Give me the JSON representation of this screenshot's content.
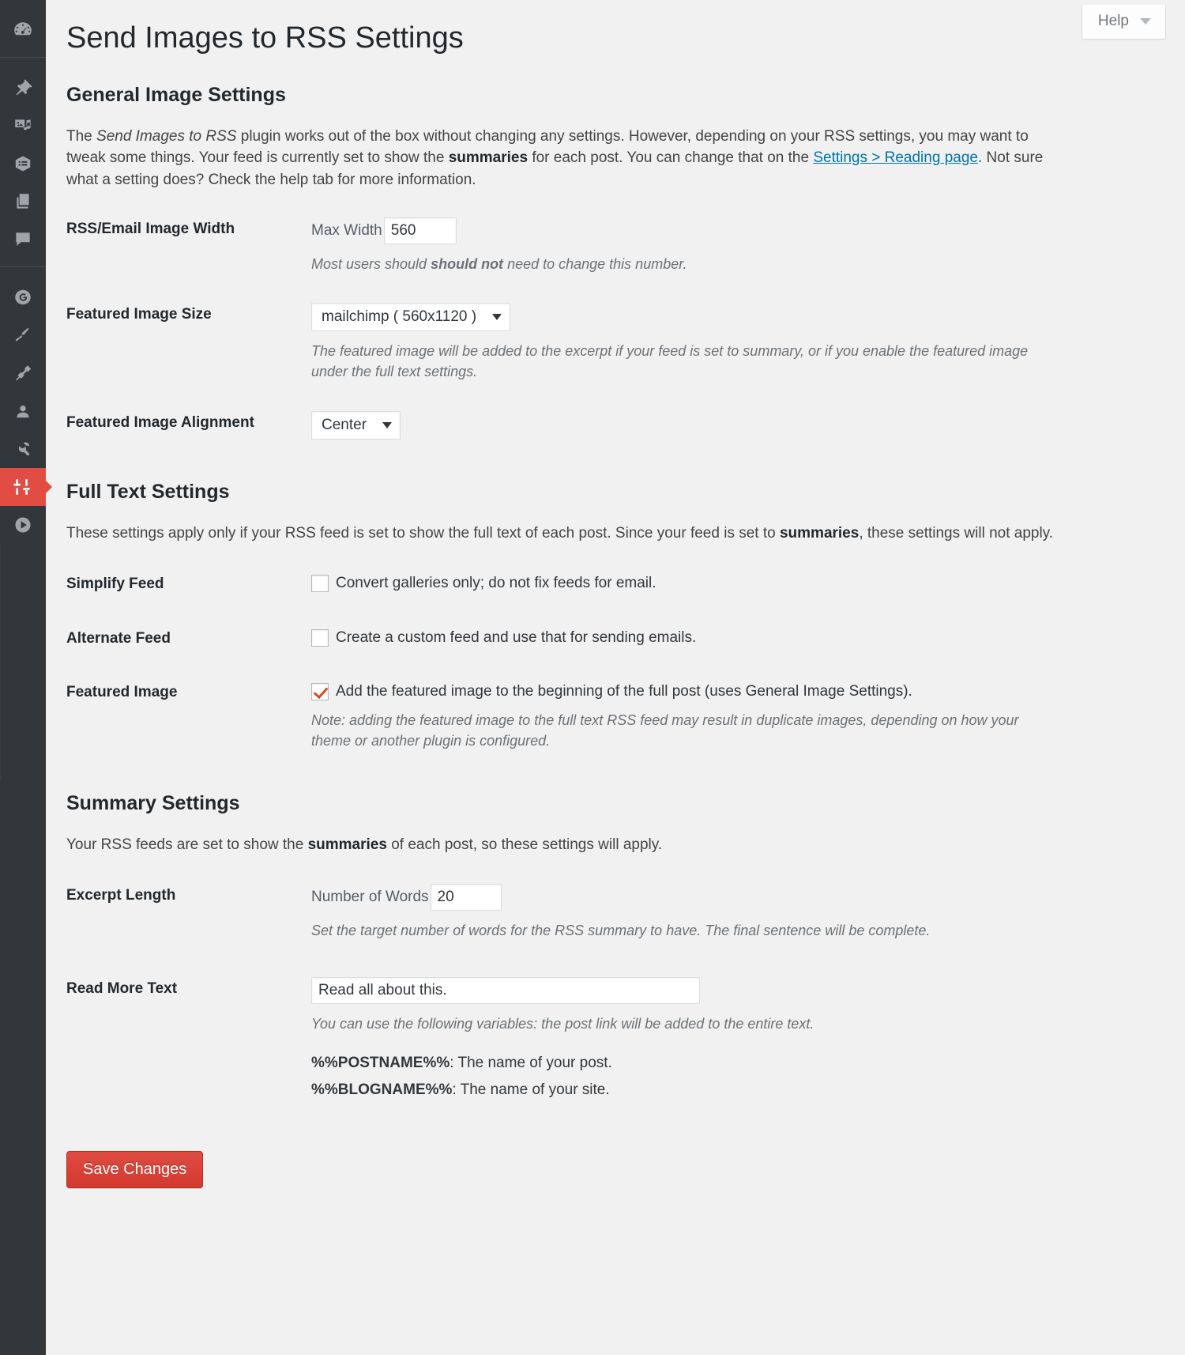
{
  "sidebar": {
    "items": [
      {
        "name": "dashboard",
        "icon": "dashboard-icon"
      },
      {
        "name": "posts",
        "icon": "pin-icon"
      },
      {
        "name": "media",
        "icon": "media-icon"
      },
      {
        "name": "forms",
        "icon": "forms-icon"
      },
      {
        "name": "pages",
        "icon": "pages-icon"
      },
      {
        "name": "comments",
        "icon": "comment-icon"
      },
      {
        "name": "genesis",
        "icon": "genesis-icon"
      },
      {
        "name": "appearance",
        "icon": "paintbrush-icon"
      },
      {
        "name": "plugins",
        "icon": "plug-icon"
      },
      {
        "name": "users",
        "icon": "user-icon"
      },
      {
        "name": "tools",
        "icon": "wrench-icon"
      },
      {
        "name": "settings",
        "icon": "settings-sliders-icon"
      },
      {
        "name": "media-player",
        "icon": "play-circle-icon"
      }
    ],
    "active_index": 11,
    "accent_color": "#e14d43",
    "background_color": "#32373c"
  },
  "help": {
    "label": "Help",
    "icon": "chevron-down-icon"
  },
  "page": {
    "title": "Send Images to RSS Settings"
  },
  "general": {
    "heading": "General Image Settings",
    "intro": {
      "part1": "The ",
      "plugin_name": "Send Images to RSS",
      "part2": " plugin works out of the box without changing any settings. However, depending on your RSS settings, you may want to tweak some things. Your feed is currently set to show the ",
      "emphasis1": "summaries",
      "part3": " for each post. You can change that on the ",
      "link_text": "Settings > Reading page",
      "part4": ". Not sure what a setting does? Check the help tab for more information."
    },
    "image_width": {
      "label": "RSS/Email Image Width",
      "field_prefix": "Max Width",
      "value": "560",
      "desc_part1": "Most users should ",
      "desc_bold": "should not",
      "desc_part2": " need to change this number."
    },
    "featured_image_size": {
      "label": "Featured Image Size",
      "selected": "mailchimp ( 560x1120 )",
      "desc": "The featured image will be added to the excerpt if your feed is set to summary, or if you enable the featured image under the full text settings."
    },
    "featured_image_alignment": {
      "label": "Featured Image Alignment",
      "selected": "Center"
    }
  },
  "full_text": {
    "heading": "Full Text Settings",
    "note_part1": "These settings apply only if your RSS feed is set to show the full text of each post. Since your feed is set to ",
    "note_bold": "summaries",
    "note_part2": ", these settings will not apply.",
    "simplify_feed": {
      "label": "Simplify Feed",
      "checkbox_label": "Convert galleries only; do not fix feeds for email.",
      "checked": false
    },
    "alternate_feed": {
      "label": "Alternate Feed",
      "checkbox_label": "Create a custom feed and use that for sending emails.",
      "checked": false
    },
    "featured_image": {
      "label": "Featured Image",
      "checkbox_label": "Add the featured image to the beginning of the full post (uses General Image Settings).",
      "checked": true,
      "desc": "Note: adding the featured image to the full text RSS feed may result in duplicate images, depending on how your theme or another plugin is configured."
    }
  },
  "summary": {
    "heading": "Summary Settings",
    "note_part1": "Your RSS feeds are set to show the ",
    "note_bold": "summaries",
    "note_part2": " of each post, so these settings will apply.",
    "excerpt_length": {
      "label": "Excerpt Length",
      "field_prefix": "Number of Words",
      "value": "20",
      "desc": "Set the target number of words for the RSS summary to have. The final sentence will be complete."
    },
    "read_more": {
      "label": "Read More Text",
      "value": "Read all about this.",
      "desc": "You can use the following variables: the post link will be added to the entire text.",
      "variables": [
        {
          "token": "%%POSTNAME%%",
          "description": ": The name of your post."
        },
        {
          "token": "%%BLOGNAME%%",
          "description": ": The name of your site."
        }
      ]
    }
  },
  "footer": {
    "save_label": "Save Changes",
    "save_color": "#d9453b"
  }
}
